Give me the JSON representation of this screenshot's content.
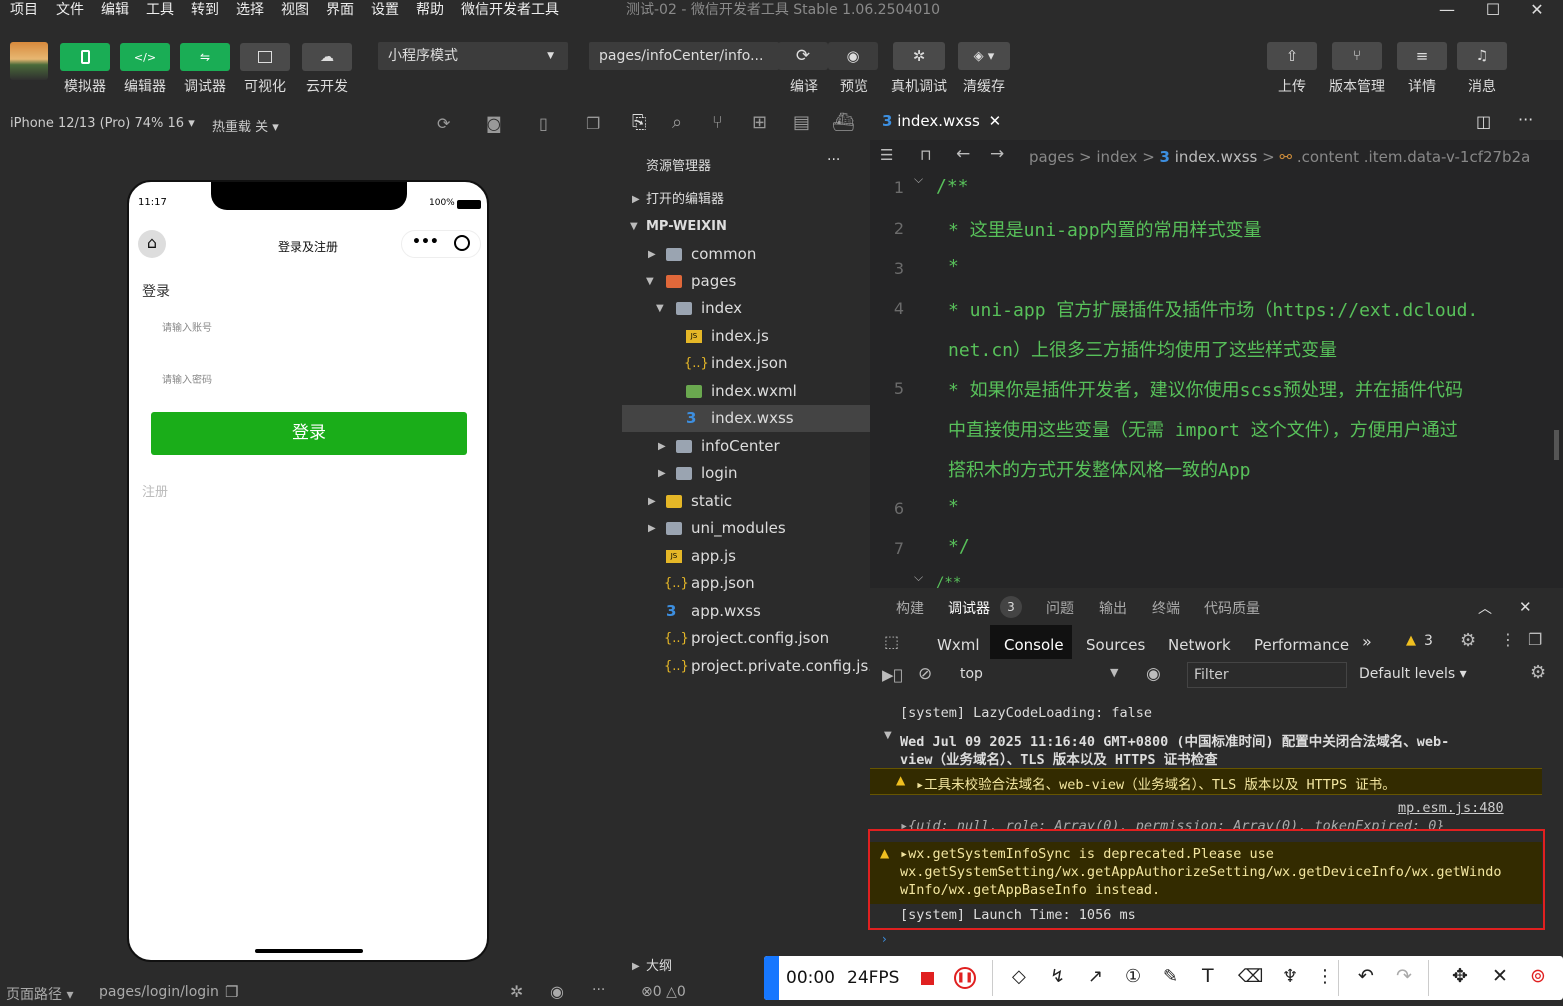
{
  "menu": [
    "项目",
    "文件",
    "编辑",
    "工具",
    "转到",
    "选择",
    "视图",
    "界面",
    "设置",
    "帮助",
    "微信开发者工具"
  ],
  "window_title": "测试-02 - 微信开发者工具 Stable 1.06.2504010",
  "toolbar": {
    "left_buttons": [
      "模拟器",
      "编辑器",
      "调试器",
      "可视化",
      "云开发"
    ],
    "mode_select": "小程序模式",
    "page_select": "pages/infoCenter/info...",
    "mid_buttons": [
      "编译",
      "预览",
      "真机调试",
      "清缓存"
    ],
    "right_buttons": [
      "上传",
      "版本管理",
      "详情",
      "消息"
    ]
  },
  "simbar": {
    "device": "iPhone 12/13 (Pro) 74% 16",
    "hotreload": "热重载 关"
  },
  "phone": {
    "time": "11:17",
    "battery": "100%",
    "nav_title": "登录及注册",
    "heading": "登录",
    "account_placeholder": "请输入账号",
    "password_placeholder": "请输入密码",
    "login_button": "登录",
    "register_link": "注册"
  },
  "explorer": {
    "title": "资源管理器",
    "open_editors": "打开的编辑器",
    "root": "MP-WEIXIN",
    "items": [
      "common",
      "pages",
      "index",
      "index.js",
      "index.json",
      "index.wxml",
      "index.wxss",
      "infoCenter",
      "login",
      "static",
      "uni_modules",
      "app.js",
      "app.json",
      "app.wxss",
      "project.config.json",
      "project.private.config.js..."
    ],
    "outline": "大纲"
  },
  "editor": {
    "tab": "index.wxss",
    "breadcrumb": [
      "pages",
      "index",
      "index.wxss",
      ".content .item.data-v-1cf27b2a"
    ],
    "line_numbers": [
      "1",
      "2",
      "3",
      "4",
      "5",
      "6",
      "7"
    ],
    "lines": [
      "/**",
      "* 这里是uni-app内置的常用样式变量",
      "*",
      "* uni-app 官方扩展插件及插件市场（https://ext.dcloud.",
      "net.cn）上很多三方插件均使用了这些样式变量",
      "* 如果你是插件开发者，建议你使用scss预处理，并在插件代码",
      "中直接使用这些变量（无需 import 这个文件），方便用户通过",
      "搭积木的方式开发整体风格一致的App",
      "*",
      "*/",
      "/**"
    ]
  },
  "devtools": {
    "tabs": [
      "构建",
      "调试器",
      "问题",
      "输出",
      "终端",
      "代码质量"
    ],
    "debugger_badge": "3",
    "console_tabs": [
      "Wxml",
      "Console",
      "Sources",
      "Network",
      "Performance"
    ],
    "warn_count": "3",
    "context": "top",
    "filter_placeholder": "Filter",
    "levels": "Default levels",
    "logs": [
      "[system] LazyCodeLoading: false",
      "Wed Jul 09 2025 11:16:40 GMT+0800 (中国标准时间) 配置中关闭合法域名、web-",
      "view（业务域名）、TLS 版本以及 HTTPS 证书检查",
      "▸工具未校验合法域名、web-view（业务域名）、TLS 版本以及 HTTPS 证书。",
      "mp.esm.js:480",
      "▸{uid: null, role: Array(0), permission: Array(0), tokenExpired: 0}",
      "▸wx.getSystemInfoSync is deprecated.Please use",
      "wx.getSystemSetting/wx.getAppAuthorizeSetting/wx.getDeviceInfo/wx.getWindo",
      "wInfo/wx.getAppBaseInfo instead.",
      "[system] Launch Time: 1056 ms"
    ]
  },
  "status": {
    "page_path_label": "页面路径",
    "page_path": "pages/login/login",
    "errors": "0",
    "warnings": "0"
  },
  "recorder": {
    "time": "00:00",
    "fps": "24FPS"
  },
  "colors": {
    "accent_green": "#1aad55",
    "warning_bg": "#332b00",
    "highlight_red": "#e02020"
  }
}
